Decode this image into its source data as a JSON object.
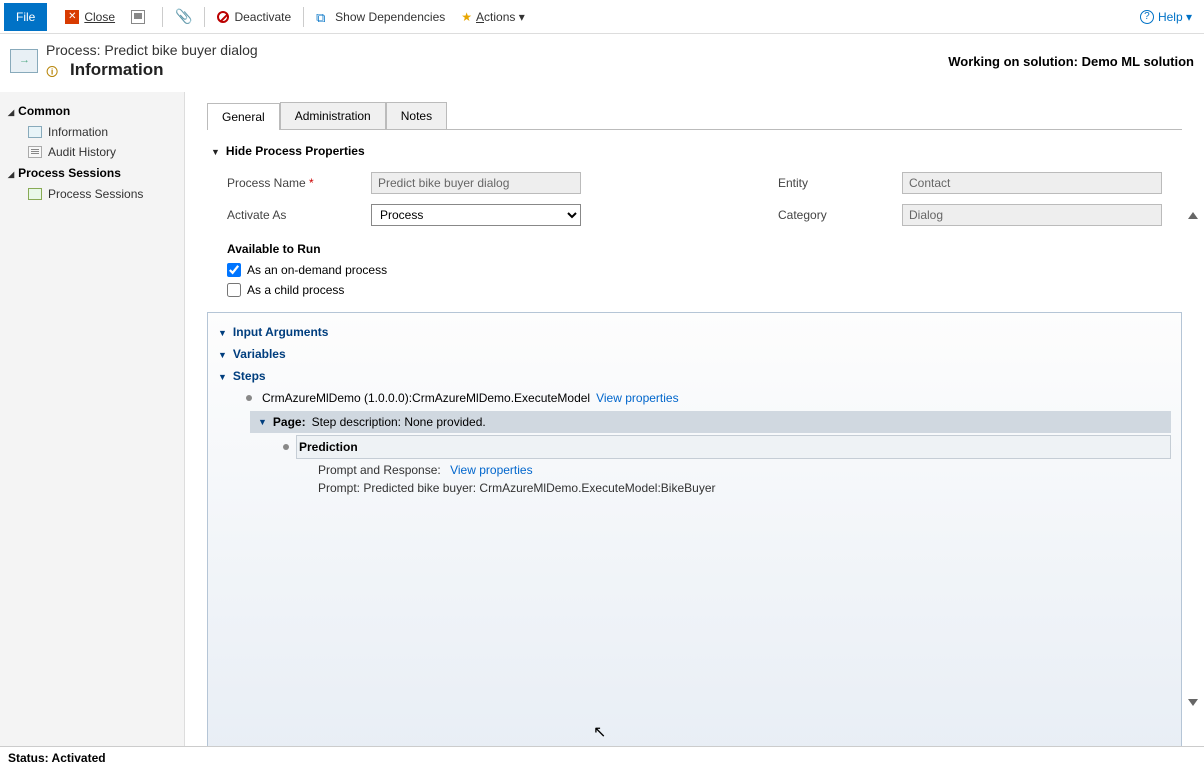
{
  "toolbar": {
    "file": "File",
    "close": "Close",
    "deactivate": "Deactivate",
    "show_deps": "Show Dependencies",
    "actions": "Actions",
    "help": "Help"
  },
  "header": {
    "process_label": "Process: Predict bike buyer dialog",
    "info_label": "Information",
    "solution_label": "Working on solution: Demo ML solution"
  },
  "nav": {
    "common": "Common",
    "information": "Information",
    "audit": "Audit History",
    "sessions_h": "Process Sessions",
    "sessions": "Process Sessions"
  },
  "tabs": {
    "general": "General",
    "administration": "Administration",
    "notes": "Notes"
  },
  "section": {
    "hide_props": "Hide Process Properties"
  },
  "form": {
    "pname_lbl": "Process Name",
    "pname_val": "Predict bike buyer dialog",
    "activate_lbl": "Activate As",
    "activate_val": "Process",
    "entity_lbl": "Entity",
    "entity_val": "Contact",
    "category_lbl": "Category",
    "category_val": "Dialog",
    "avail_h": "Available to Run",
    "chk_ondemand": "As an on-demand process",
    "chk_child": "As a child process"
  },
  "steps": {
    "input_args": "Input Arguments",
    "variables": "Variables",
    "steps": "Steps",
    "exec": "CrmAzureMlDemo (1.0.0.0):CrmAzureMlDemo.ExecuteModel",
    "view_props": "View properties",
    "page_lbl": "Page:",
    "page_desc": "Step description: None provided.",
    "prediction": "Prediction",
    "prompt_resp": "Prompt and Response:",
    "prompt_line": "Prompt:  Predicted bike buyer: CrmAzureMlDemo.ExecuteModel:BikeBuyer"
  },
  "status": "Status: Activated"
}
